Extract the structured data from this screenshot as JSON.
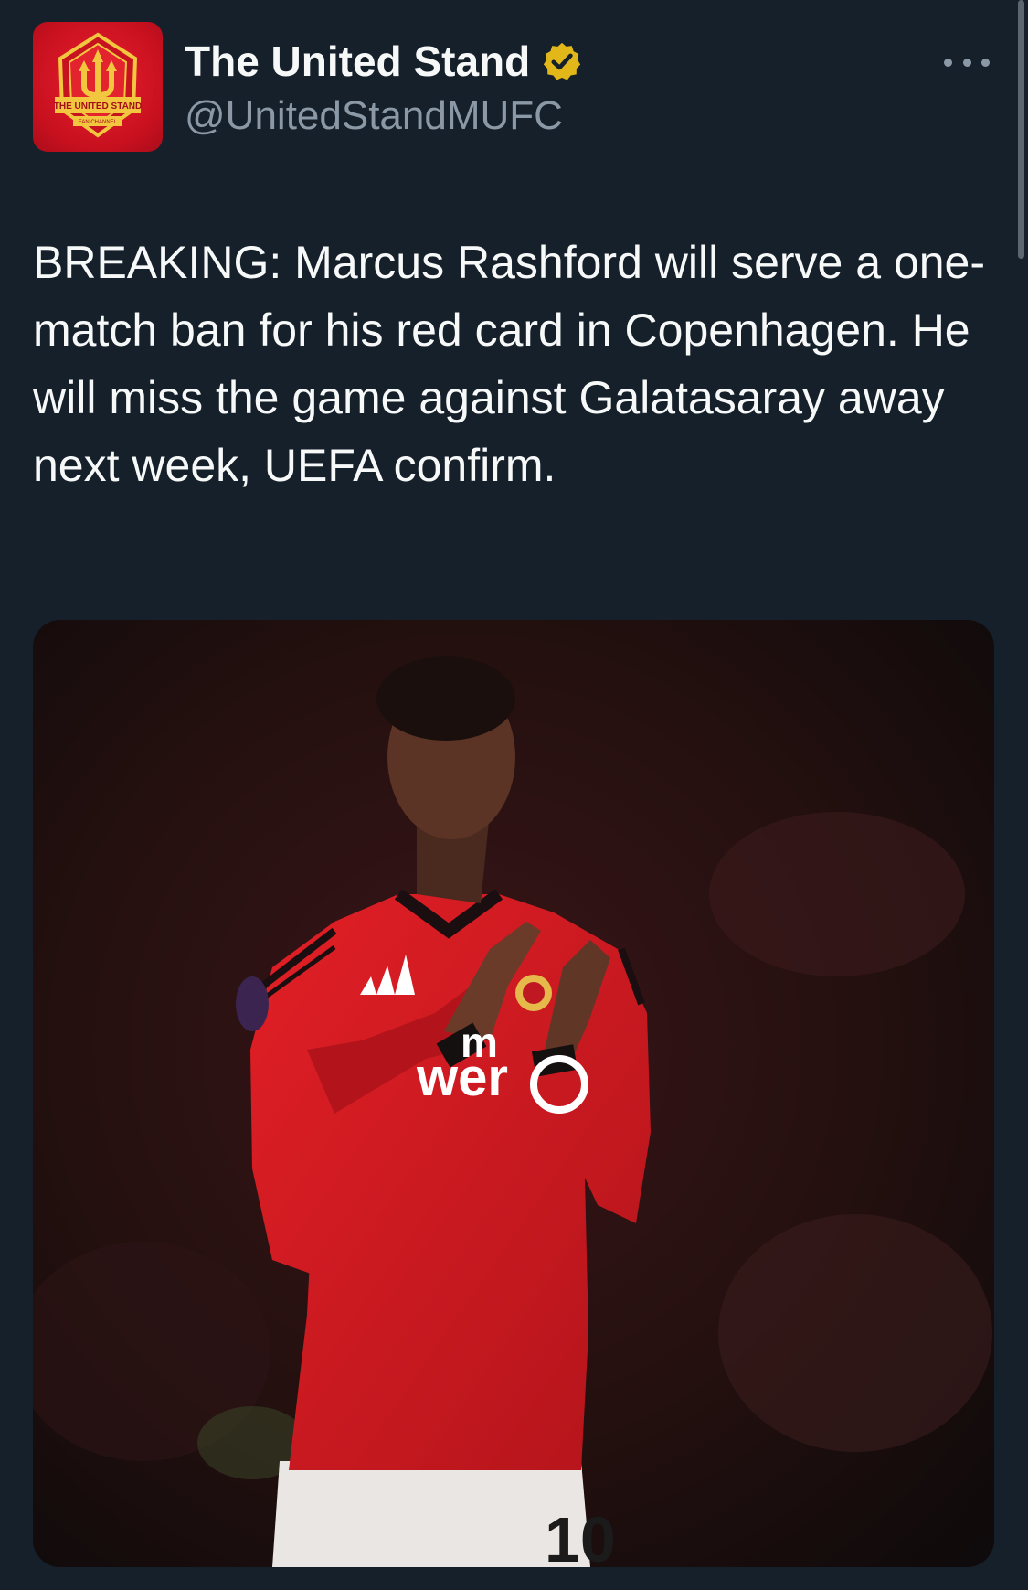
{
  "author": {
    "display_name": "The United Stand",
    "handle": "@UnitedStandMUFC",
    "avatar_text": "THE UNITED STAND",
    "avatar_subtext": "FAN CHANNEL",
    "verified_color": "#e2b719"
  },
  "tweet": {
    "text": "BREAKING: Marcus Rashford will serve a one-match ban for his red card in Copenhagen. He will miss the game against Galatasaray away next week, UEFA confirm."
  },
  "media": {
    "kit_sponsor_text": "wer",
    "sponsor_partial": "m",
    "shirt_number": "10"
  },
  "icons": {
    "verified": "verified-badge-icon",
    "more": "more-options-icon"
  },
  "colors": {
    "background": "#15202b",
    "text_primary": "#f7f9f9",
    "text_secondary": "#8b98a5",
    "kit_red": "#d5191f"
  }
}
